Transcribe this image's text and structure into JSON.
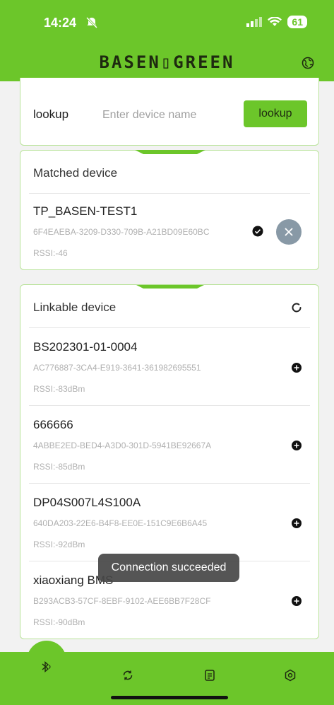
{
  "status": {
    "time": "14:24",
    "battery": "61"
  },
  "header": {
    "logo": "BASEN▯GREEN"
  },
  "lookup": {
    "label": "lookup",
    "placeholder": "Enter device name",
    "button": "lookup"
  },
  "matched": {
    "title": "Matched device",
    "device": {
      "name": "TP_BASEN-TEST1",
      "uuid": "6F4EAEBA-3209-D330-709B-A21BD09E60BC",
      "rssi": "RSSI:-46"
    }
  },
  "linkable": {
    "title": "Linkable device",
    "devices": [
      {
        "name": "BS202301-01-0004",
        "uuid": "AC776887-3CA4-E919-3641-361982695551",
        "rssi": "RSSI:-83dBm"
      },
      {
        "name": "666666",
        "uuid": "4ABBE2ED-BED4-A3D0-301D-5941BE92667A",
        "rssi": "RSSI:-85dBm"
      },
      {
        "name": "DP04S007L4S100A",
        "uuid": "640DA203-22E6-B4F8-EE0E-151C9E6B6A45",
        "rssi": "RSSI:-92dBm"
      },
      {
        "name": "xiaoxiang BMS",
        "uuid": "B293ACB3-57CF-8EBF-9102-AEE6BB7F28CF",
        "rssi": "RSSI:-90dBm"
      }
    ]
  },
  "toast": "Connection succeeded",
  "colors": {
    "accent": "#6cc62a",
    "card_border": "#b9e39a"
  },
  "tabbar": {
    "icons": [
      "bluetooth-icon",
      "refresh-icon",
      "document-icon",
      "settings-icon"
    ]
  }
}
